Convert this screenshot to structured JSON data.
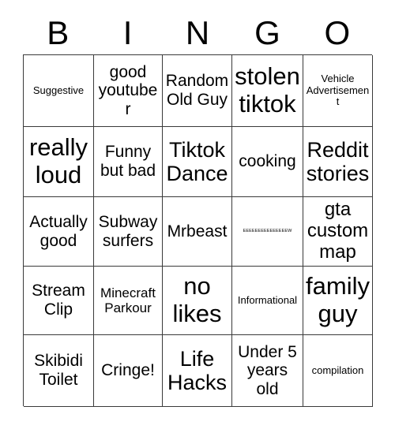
{
  "card": {
    "header": [
      "B",
      "I",
      "N",
      "G",
      "O"
    ],
    "rows": [
      [
        {
          "text": "Suggestive",
          "size": "xs"
        },
        {
          "text": "good youtuber",
          "size": "md"
        },
        {
          "text": "Random Old Guy",
          "size": "md"
        },
        {
          "text": "stolen tiktok",
          "size": "xxl"
        },
        {
          "text": "Vehicle Advertisement",
          "size": "xs"
        }
      ],
      [
        {
          "text": "really loud",
          "size": "xxl"
        },
        {
          "text": "Funny but bad",
          "size": "md"
        },
        {
          "text": "Tiktok Dance",
          "size": "xl"
        },
        {
          "text": "cooking",
          "size": "md"
        },
        {
          "text": "Reddit stories",
          "size": "xl"
        }
      ],
      [
        {
          "text": "Actually good",
          "size": "md"
        },
        {
          "text": "Subway surfers",
          "size": "md"
        },
        {
          "text": "Mrbeast",
          "size": "md"
        },
        {
          "text": "EEEEEEEEEEEEEEEW",
          "size": "tiny"
        },
        {
          "text": "gta custom map",
          "size": "lg"
        }
      ],
      [
        {
          "text": "Stream Clip",
          "size": "md"
        },
        {
          "text": "Minecraft Parkour",
          "size": "sm"
        },
        {
          "text": "no likes",
          "size": "xxl"
        },
        {
          "text": "Informational",
          "size": "xs"
        },
        {
          "text": "family guy",
          "size": "xxl"
        }
      ],
      [
        {
          "text": "Skibidi Toilet",
          "size": "md"
        },
        {
          "text": "Cringe!",
          "size": "md"
        },
        {
          "text": "Life Hacks",
          "size": "xl"
        },
        {
          "text": "Under 5 years old",
          "size": "md"
        },
        {
          "text": "compilation",
          "size": "xs"
        }
      ]
    ]
  },
  "colors": {
    "border": "#3a3a3a",
    "background": "#ffffff",
    "text": "#000000"
  }
}
